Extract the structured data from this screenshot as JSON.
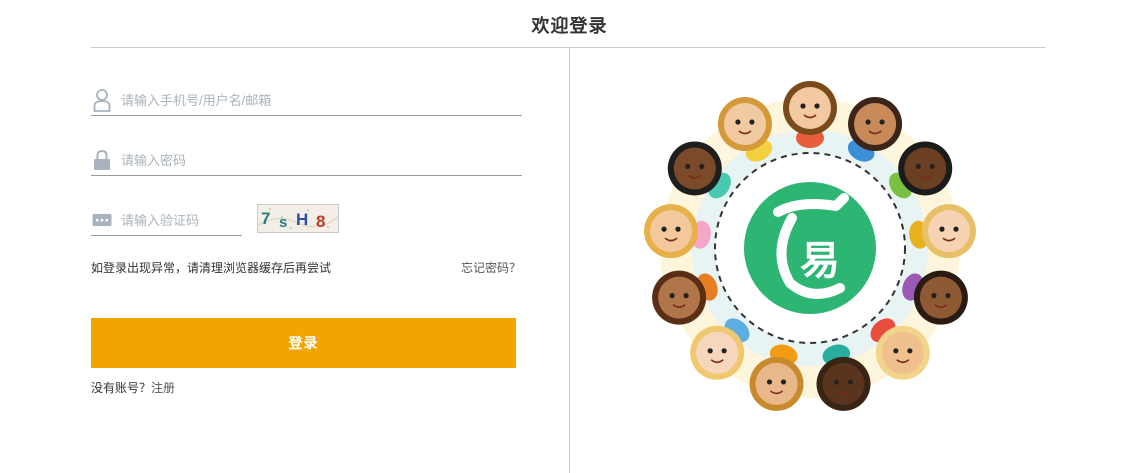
{
  "page": {
    "title": "欢迎登录"
  },
  "form": {
    "username_placeholder": "请输入手机号/用户名/邮箱",
    "password_placeholder": "请输入密码",
    "captcha_placeholder": "请输入验证码",
    "captcha_text": "7sH8",
    "hint": "如登录出现异常，请清理浏览器缓存后再尝试",
    "forgot_label": "忘记密码？",
    "login_label": "登录",
    "no_account_label": "没有账号？",
    "register_label": "注册"
  },
  "icons": {
    "user": "user-icon",
    "lock": "lock-icon",
    "code": "keyboard-icon",
    "logo": "logo-icon"
  },
  "colors": {
    "accent": "#f2a400",
    "logo_green": "#2db573",
    "icon_gray": "#a9b3bd"
  }
}
